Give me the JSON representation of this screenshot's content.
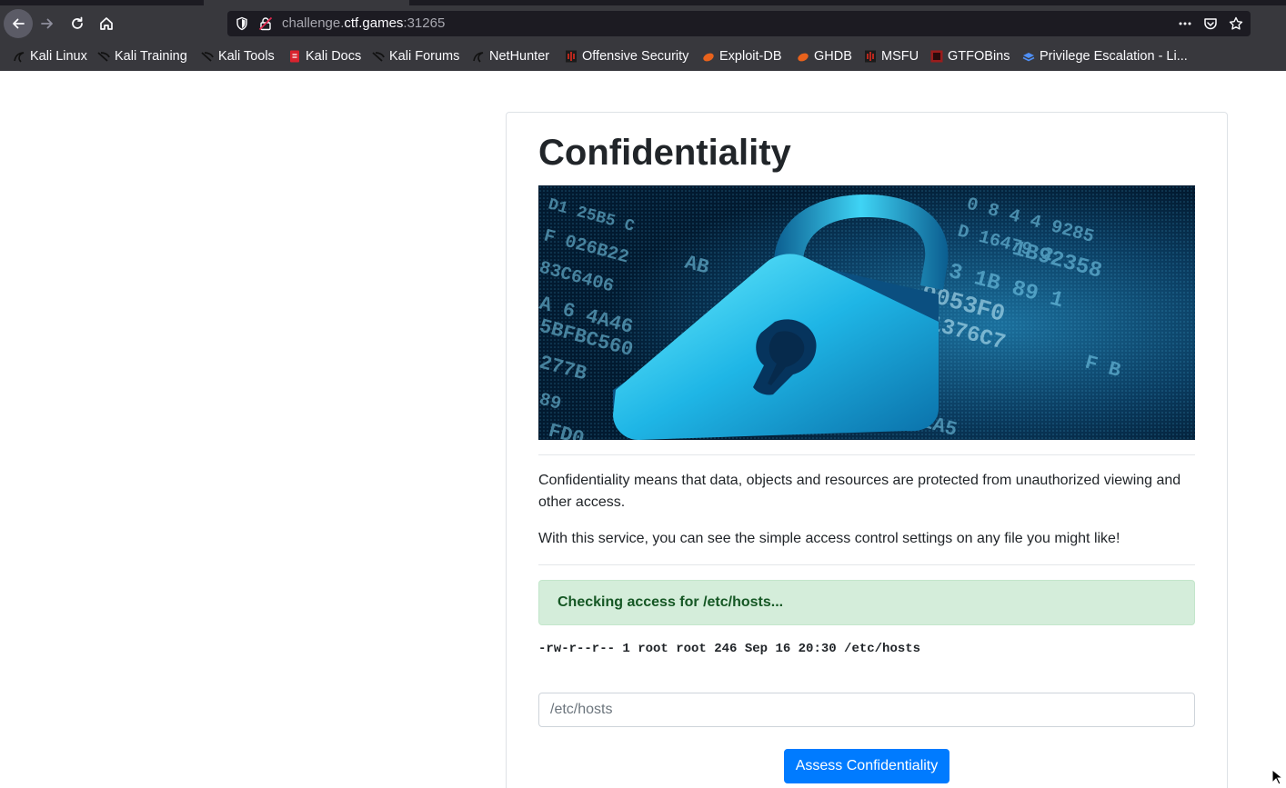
{
  "browser": {
    "url_prefix": "challenge.",
    "url_host": "ctf.games",
    "url_suffix": ":31265",
    "bookmarks": [
      {
        "label": "Kali Linux",
        "icon": "kali-dragon-icon"
      },
      {
        "label": "Kali Training",
        "icon": "kali-dragon-icon"
      },
      {
        "label": "Kali Tools",
        "icon": "kali-dragon-icon"
      },
      {
        "label": "Kali Docs",
        "icon": "kali-docs-icon"
      },
      {
        "label": "Kali Forums",
        "icon": "kali-dragon-icon"
      },
      {
        "label": "NetHunter",
        "icon": "nethunter-icon"
      },
      {
        "label": "Offensive Security",
        "icon": "offsec-icon"
      },
      {
        "label": "Exploit-DB",
        "icon": "exploitdb-icon"
      },
      {
        "label": "GHDB",
        "icon": "exploitdb-icon"
      },
      {
        "label": "MSFU",
        "icon": "offsec-icon"
      },
      {
        "label": "GTFOBins",
        "icon": "gtfobins-icon"
      },
      {
        "label": "Privilege Escalation - Li...",
        "icon": "book-icon"
      }
    ]
  },
  "page": {
    "title": "Confidentiality",
    "description_1": "Confidentiality means that data, objects and resources are protected from unauthorized viewing and other access.",
    "description_2": "With this service, you can see the simple access control settings on any file you might like!",
    "alert": "Checking access for /etc/hosts...",
    "ls_output": "-rw-r--r-- 1 root root 246 Sep 16 20:30 /etc/hosts",
    "input_placeholder": "/etc/hosts",
    "input_value": "",
    "button_label": "Assess Confidentiality"
  },
  "colors": {
    "chrome_bg": "#38383d",
    "urlbar_bg": "#1c1b22",
    "alert_bg": "#d4edda",
    "alert_text": "#155724",
    "primary": "#007bff"
  }
}
